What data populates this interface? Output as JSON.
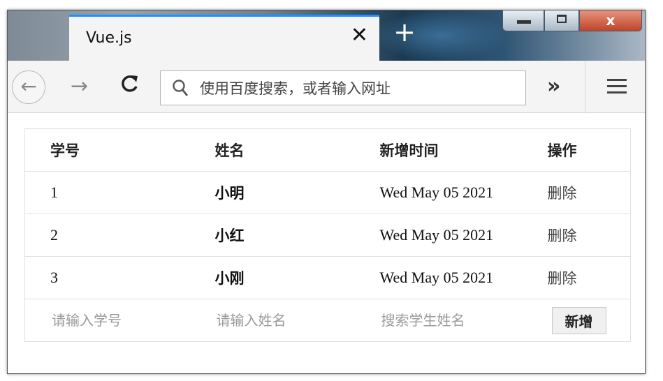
{
  "tab": {
    "title": "Vue.js",
    "close": "✕"
  },
  "new_tab": "+",
  "window_controls": {
    "minimize": "",
    "maximize": "",
    "close": "x"
  },
  "nav": {
    "back": "←",
    "forward": "→",
    "reload": "C",
    "url_placeholder": "使用百度搜索，或者输入网址",
    "overflow": "»"
  },
  "table": {
    "headers": [
      "学号",
      "姓名",
      "新增时间",
      "操作"
    ],
    "rows": [
      {
        "id": "1",
        "name": "小明",
        "time": "Wed May 05 2021",
        "action": "删除"
      },
      {
        "id": "2",
        "name": "小红",
        "time": "Wed May 05 2021",
        "action": "删除"
      },
      {
        "id": "3",
        "name": "小刚",
        "time": "Wed May 05 2021",
        "action": "删除"
      }
    ],
    "form": {
      "id_placeholder": "请输入学号",
      "name_placeholder": "请输入姓名",
      "search_placeholder": "搜索学生姓名",
      "add_label": "新增"
    }
  },
  "colors": {
    "tab_accent": "#1e90ff",
    "close_button": "#c0442a"
  }
}
